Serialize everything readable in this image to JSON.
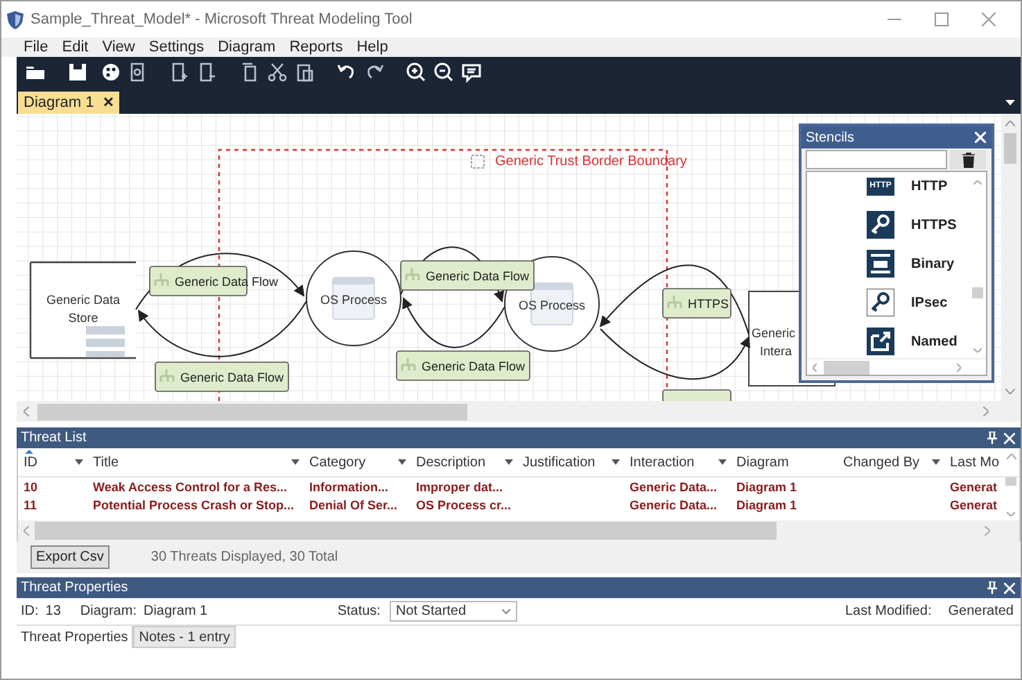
{
  "window": {
    "title": "Sample_Threat_Model* - Microsoft Threat Modeling Tool"
  },
  "menu": [
    "File",
    "Edit",
    "View",
    "Settings",
    "Diagram",
    "Reports",
    "Help"
  ],
  "tabs": [
    {
      "label": "Diagram 1",
      "close": "✕",
      "selected": true
    }
  ],
  "diagram": {
    "boundary": {
      "label": "Generic Trust Border Boundary"
    },
    "nodes": [
      {
        "kind": "store",
        "lines": [
          "Generic Data",
          "Store"
        ]
      },
      {
        "kind": "process",
        "lines": [
          "OS Process"
        ]
      },
      {
        "kind": "process",
        "lines": [
          "OS Process"
        ]
      },
      {
        "kind": "interactor",
        "lines": [
          "Generic",
          "Intera"
        ]
      }
    ],
    "flows": [
      {
        "label": "Generic Data Flow"
      },
      {
        "label": "Generic Data Flow"
      },
      {
        "label": "Generic Data Flow"
      },
      {
        "label": "Generic Data Flow"
      },
      {
        "label": "HTTPS"
      }
    ]
  },
  "stencils": {
    "title": "Stencils",
    "items": [
      {
        "label": "HTTP",
        "badge": "HTTP"
      },
      {
        "label": "HTTPS"
      },
      {
        "label": "Binary"
      },
      {
        "label": "IPsec"
      },
      {
        "label": "Named"
      }
    ]
  },
  "threat_list": {
    "title": "Threat List",
    "columns": [
      {
        "label": "ID",
        "filter": true,
        "sorted": true
      },
      {
        "label": "Title",
        "filter": true,
        "sorted": false
      },
      {
        "label": "Category",
        "filter": true,
        "sorted": false
      },
      {
        "label": "Description",
        "filter": true,
        "sorted": false
      },
      {
        "label": "Justification",
        "filter": true,
        "sorted": false
      },
      {
        "label": "Interaction",
        "filter": true,
        "sorted": false
      },
      {
        "label": "Diagram",
        "filter": false,
        "sorted": false
      },
      {
        "label": "Changed By",
        "filter": true,
        "sorted": false
      },
      {
        "label": "Last Mo",
        "filter": false,
        "sorted": false
      }
    ],
    "rows": [
      {
        "id": "10",
        "title": "Weak Access Control for a Res...",
        "category": "Information...",
        "description": "Improper dat...",
        "interaction": "Generic Data...",
        "diagram": "Diagram 1",
        "last_modified": "Generat"
      },
      {
        "id": "11",
        "title": "Potential Process Crash or Stop...",
        "category": "Denial Of Ser...",
        "description": "OS Process cr...",
        "interaction": "Generic Data...",
        "diagram": "Diagram 1",
        "last_modified": "Generat"
      }
    ],
    "export_button": "Export Csv",
    "summary": "30 Threats Displayed, 30 Total"
  },
  "threat_properties": {
    "title": "Threat Properties",
    "id_label": "ID:",
    "id": "13",
    "diagram_label": "Diagram:",
    "diagram": "Diagram 1",
    "status_label": "Status:",
    "status": "Not Started",
    "modified_label": "Last Modified:",
    "modified": "Generated",
    "tabs": [
      {
        "label": "Threat Properties",
        "selected": true
      },
      {
        "label": "Notes - 1 entry",
        "selected": false
      }
    ]
  }
}
